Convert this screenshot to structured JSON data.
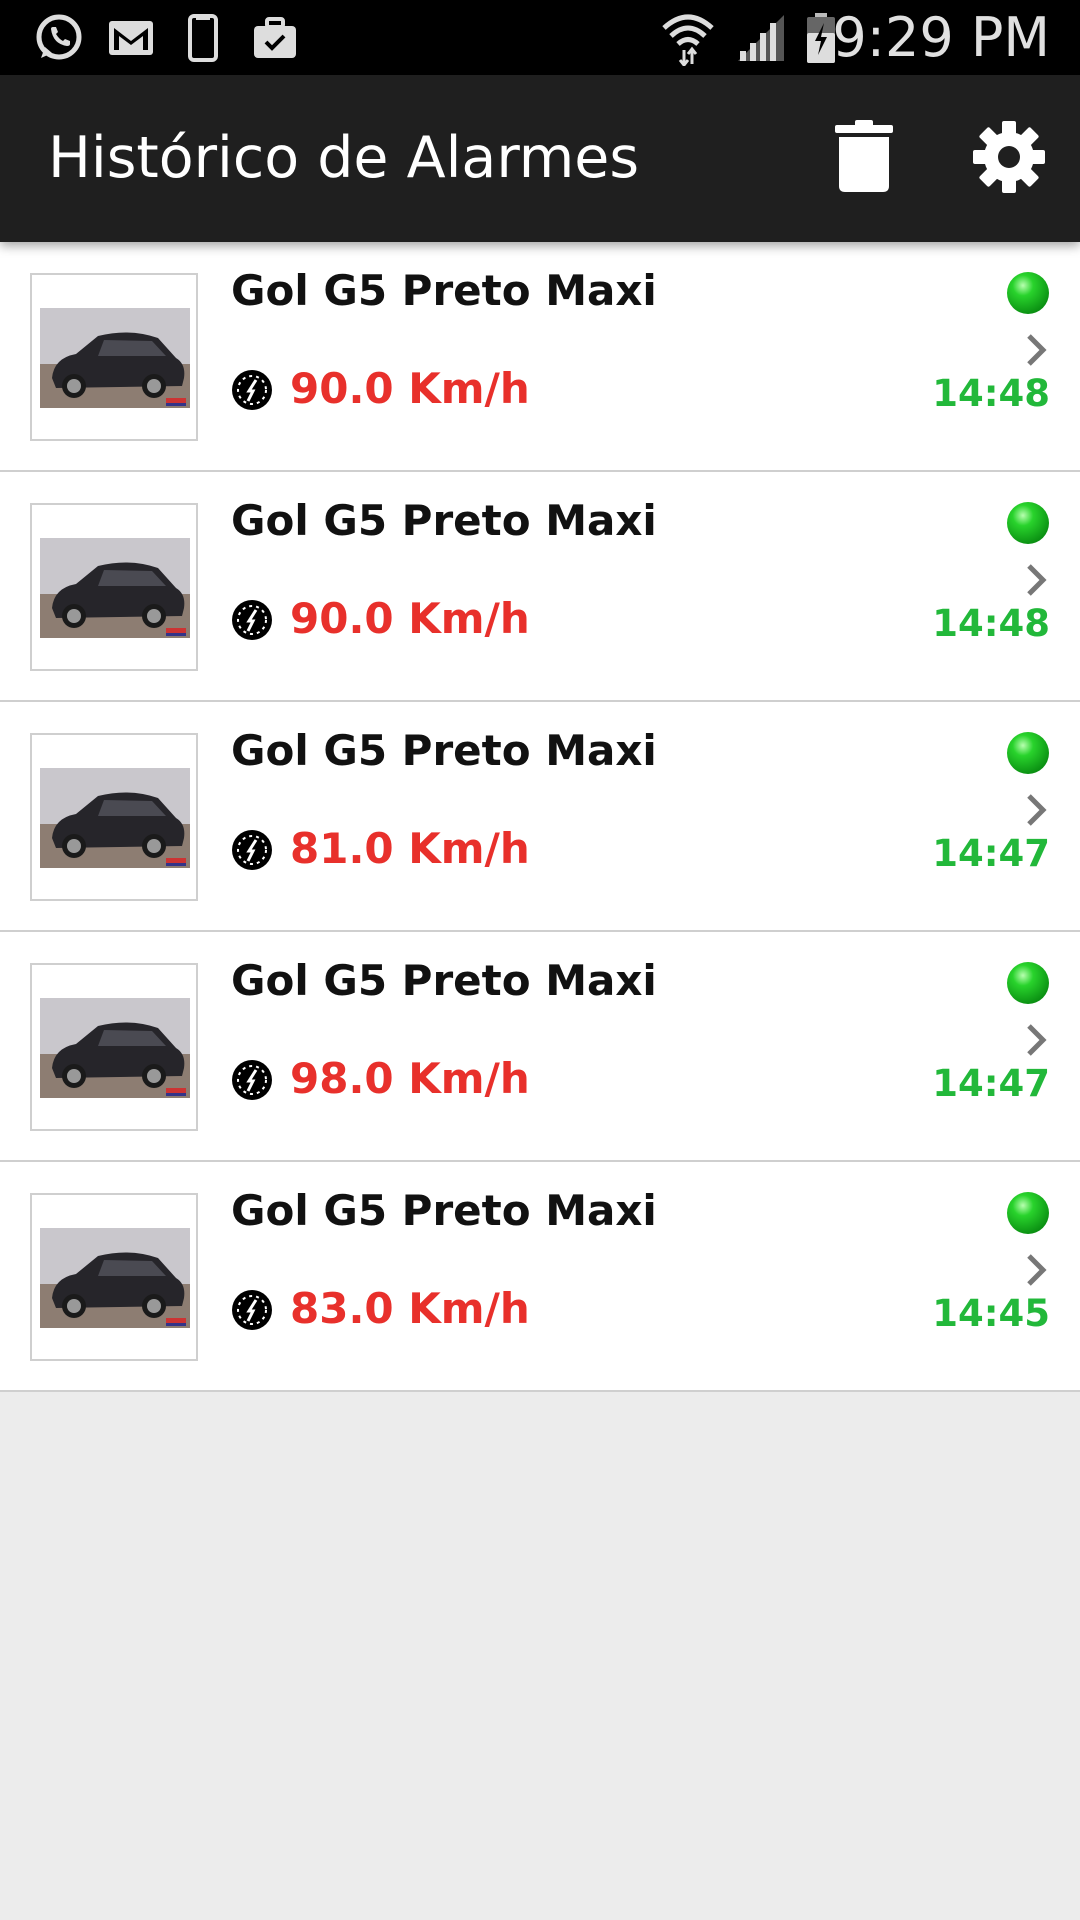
{
  "status_bar": {
    "time": "9:29 PM",
    "icons": [
      "whatsapp-icon",
      "gmail-icon",
      "phone-icon",
      "briefcase-check-icon",
      "wifi-icon",
      "signal-icon",
      "battery-icon"
    ]
  },
  "app_bar": {
    "title": "Histórico de Alarmes",
    "actions": [
      "trash-icon",
      "settings-gear-icon"
    ]
  },
  "colors": {
    "app_bar": "#1f1f1f",
    "speed_red": "#e8302b",
    "time_green": "#22b83a",
    "status_dot": "#16c21a",
    "background": "#ececec"
  },
  "alarms": [
    {
      "vehicle": "Gol G5 Preto Maxi",
      "speed": "90.0 Km/h",
      "time": "14:48"
    },
    {
      "vehicle": "Gol G5 Preto Maxi",
      "speed": "90.0 Km/h",
      "time": "14:48"
    },
    {
      "vehicle": "Gol G5 Preto Maxi",
      "speed": "81.0 Km/h",
      "time": "14:47"
    },
    {
      "vehicle": "Gol G5 Preto Maxi",
      "speed": "98.0 Km/h",
      "time": "14:47"
    },
    {
      "vehicle": "Gol G5 Preto Maxi",
      "speed": "83.0 Km/h",
      "time": "14:45"
    }
  ]
}
